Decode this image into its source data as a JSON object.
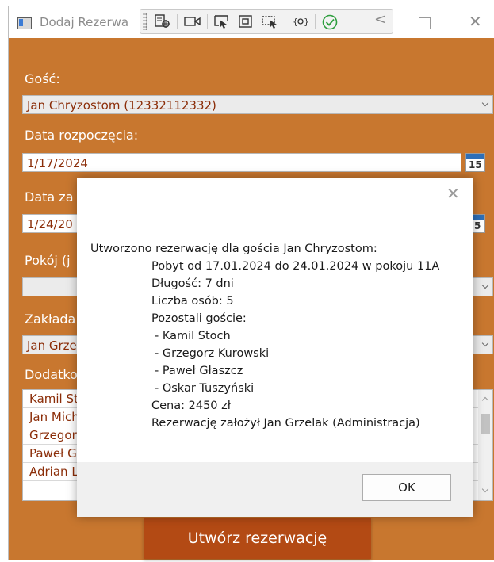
{
  "window": {
    "title": "Dodaj Rezerwa",
    "maximize_label": "□",
    "close_label": "✕"
  },
  "toolbar": {
    "icons": [
      "select-element-icon",
      "video-camera-icon",
      "pointer-select-icon",
      "track-focused-icon",
      "display-layout-adorners-icon",
      "hot-reload-icon",
      "checkmark-icon",
      "collapse-chevron-icon"
    ],
    "chevron": "<"
  },
  "form": {
    "guest_label": "Gość:",
    "guest_value": "Jan Chryzostom (12332112332)",
    "start_label": "Data rozpoczęcia:",
    "start_value": "1/17/2024",
    "end_label": "Data za",
    "end_value": "1/24/20",
    "room_label": "Pokój (j",
    "room_value": "",
    "creator_label": "Zakłada",
    "creator_value": "Jan Grze",
    "extra_label": "Dodatko",
    "calendar_day": "15",
    "calendar_day_partial": "5",
    "extra_guests": [
      "Kamil St",
      "Jan Mich",
      "Grzegor",
      "Paweł G",
      "Adrian L"
    ],
    "submit_label": "Utwórz rezerwację"
  },
  "dialog": {
    "close": "✕",
    "line1": "Utworzono rezerwację dla gościa Jan Chryzostom:",
    "line2": "Pobyt od 17.01.2024 do 24.01.2024 w pokoju 11A",
    "line3": "Długość: 7 dni",
    "line4": "Liczba osób: 5",
    "line5": "Pozostali goście:",
    "guests": [
      "- Kamil Stoch",
      "- Grzegorz Kurowski",
      "- Paweł Głaszcz",
      "- Oskar Tuszyński"
    ],
    "price": "Cena: 2450 zł",
    "creator": "Rezerwację założył Jan Grzelak (Administracja)",
    "ok_label": "OK"
  },
  "colors": {
    "panel": "#c8772f",
    "button": "#b34a14",
    "value_text": "#8b2d08"
  }
}
